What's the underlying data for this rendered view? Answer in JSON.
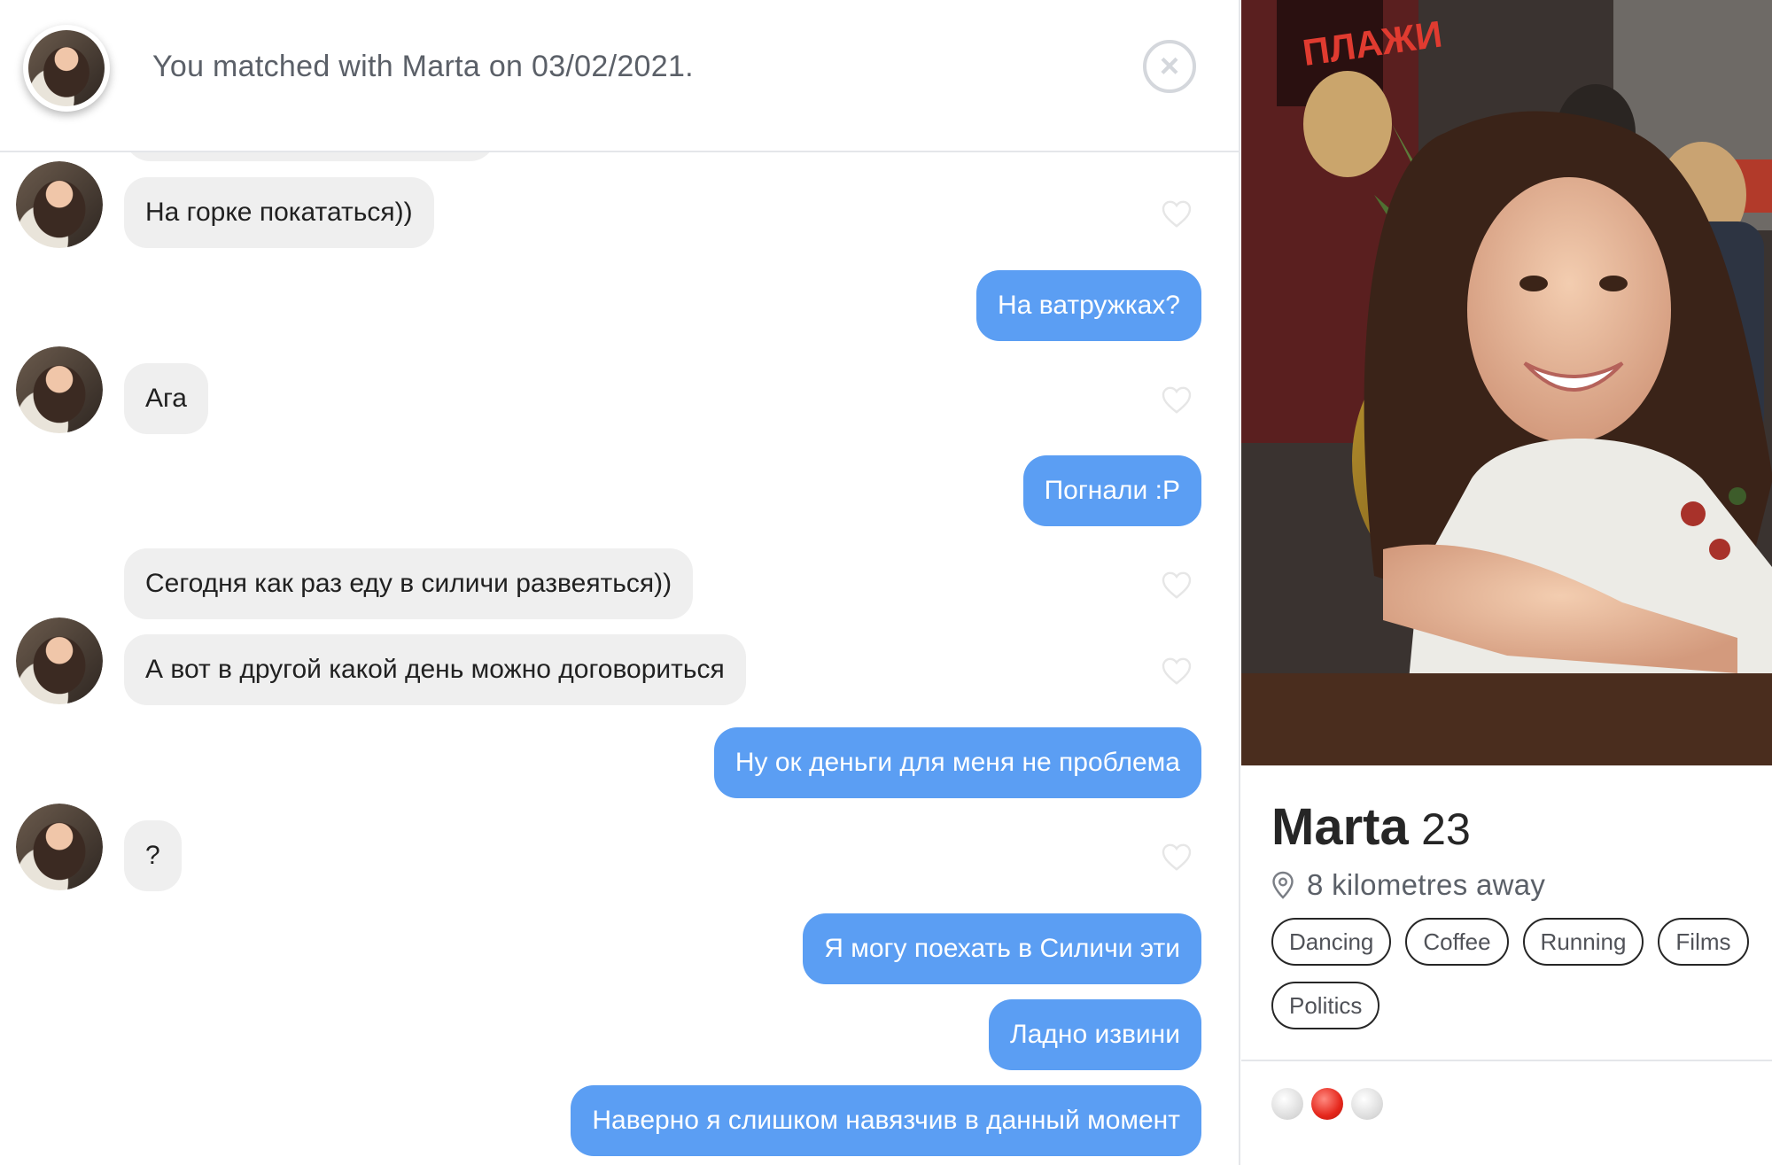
{
  "header": {
    "match_text": "You matched with Marta on 03/02/2021.",
    "close_icon": "×"
  },
  "messages": [
    {
      "side": "in",
      "text": "На горке покататься))",
      "avatar": true
    },
    {
      "side": "out",
      "text": "На ватружках?"
    },
    {
      "side": "in",
      "text": "Ага",
      "avatar": true
    },
    {
      "side": "out",
      "text": "Погнали :P"
    },
    {
      "side": "in",
      "text": "Сегодня как раз еду в силичи развеяться))",
      "avatar": false
    },
    {
      "side": "in",
      "text": "А вот в другой какой день можно договориться",
      "avatar": true
    },
    {
      "side": "out",
      "text": "Ну ок деньги для меня не проблема"
    },
    {
      "side": "in",
      "text": "?",
      "avatar": true
    },
    {
      "side": "out",
      "text": "Я могу поехать в Силичи эти"
    },
    {
      "side": "out",
      "text": "Ладно извини"
    },
    {
      "side": "out",
      "text": "Наверно я слишком навязчив в данный момент"
    }
  ],
  "profile": {
    "name": "Marta",
    "age": "23",
    "distance": "8 kilometres away",
    "interests": [
      "Dancing",
      "Coffee",
      "Running",
      "Films",
      "Politics"
    ],
    "photo_sign_text": "ПЛАЖИ",
    "photo_count": 3,
    "active_photo": 2
  },
  "colors": {
    "outgoing_bubble": "#5b9ef3",
    "incoming_bubble": "#efefef",
    "active_dot": "#e5261b"
  },
  "icons": {
    "close": "close-icon",
    "like": "heart-icon",
    "location": "location-pin-icon"
  }
}
